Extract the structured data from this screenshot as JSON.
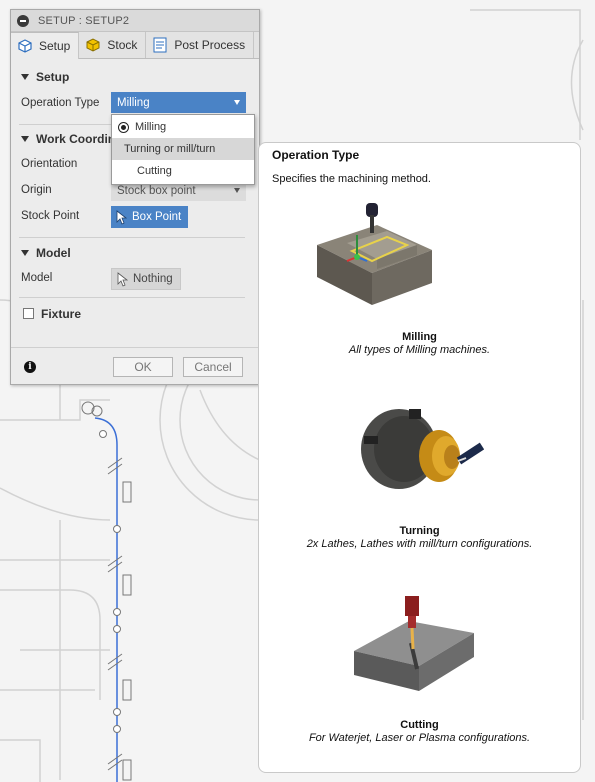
{
  "dialog": {
    "title": "SETUP : SETUP2",
    "tabs": [
      {
        "label": "Setup"
      },
      {
        "label": "Stock"
      },
      {
        "label": "Post Process"
      }
    ],
    "setup_section": {
      "heading": "Setup",
      "operation_type_label": "Operation Type",
      "operation_type_value": "Milling"
    },
    "work_coordinate_section": {
      "heading": "Work Coordinate System",
      "orientation_label": "Orientation",
      "origin_label": "Origin",
      "origin_value": "Stock box point",
      "stock_point_label": "Stock Point",
      "stock_point_button": "Box Point"
    },
    "model_section": {
      "heading": "Model",
      "model_label": "Model",
      "model_button": "Nothing"
    },
    "fixture_label": "Fixture",
    "ok_label": "OK",
    "cancel_label": "Cancel"
  },
  "dropdown": {
    "options": [
      {
        "label": "Milling",
        "selected": true
      },
      {
        "label": "Turning or mill/turn",
        "hovered": true
      },
      {
        "label": "Cutting"
      }
    ]
  },
  "tooltip": {
    "title": "Operation Type",
    "description": "Specifies the machining method.",
    "options": [
      {
        "name": "Milling",
        "description": "All types of Milling machines."
      },
      {
        "name": "Turning",
        "description": "2x Lathes, Lathes with mill/turn configurations."
      },
      {
        "name": "Cutting",
        "description": "For Waterjet, Laser or Plasma configurations."
      }
    ]
  },
  "colors": {
    "accent": "#4a83c6",
    "toolpath": "#3b6fd6"
  }
}
